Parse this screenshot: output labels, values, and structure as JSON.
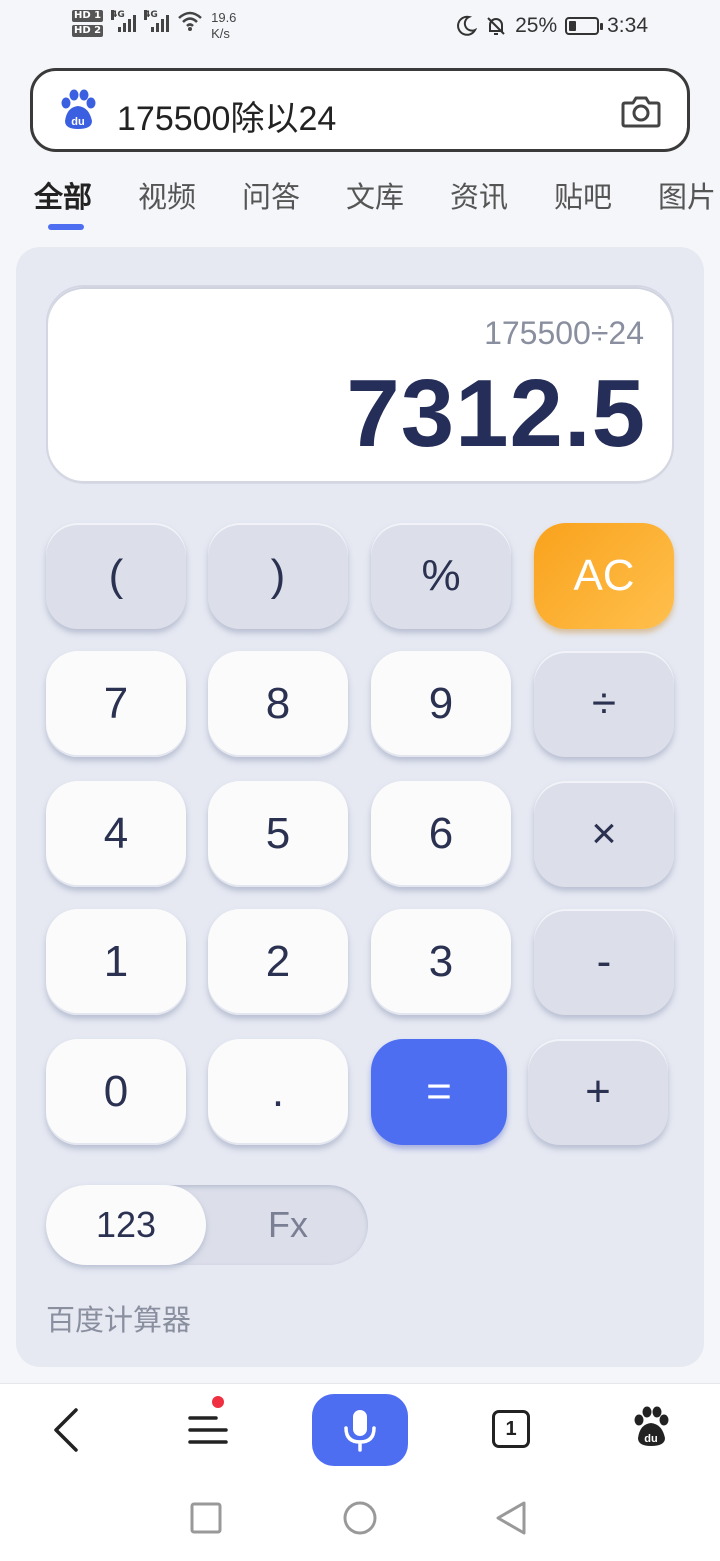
{
  "status": {
    "hd_labels": [
      "HD 1",
      "HD 2"
    ],
    "network": [
      "4G",
      "4G"
    ],
    "speed_value": "19.6",
    "speed_unit": "K/s",
    "battery": "25%",
    "battery_level": 0.25,
    "time": "3:34"
  },
  "search": {
    "query": "175500除以24",
    "logo": "baidu-paw-logo",
    "camera_icon": "camera-icon"
  },
  "tabs": [
    {
      "label": "全部",
      "active": true
    },
    {
      "label": "视频"
    },
    {
      "label": "问答"
    },
    {
      "label": "文库"
    },
    {
      "label": "资讯"
    },
    {
      "label": "贴吧"
    },
    {
      "label": "图片"
    }
  ],
  "calculator": {
    "expression": "175500÷24",
    "result": "7312.5",
    "keys": [
      [
        "(",
        ")",
        "%",
        "AC"
      ],
      [
        "7",
        "8",
        "9",
        "÷"
      ],
      [
        "4",
        "5",
        "6",
        "×"
      ],
      [
        "1",
        "2",
        "3",
        "-"
      ],
      [
        "0",
        ".",
        "=",
        "+"
      ]
    ],
    "mode_basic": "123",
    "mode_function": "Fx",
    "label": "百度计算器",
    "colors": {
      "ac": "#f9a21c",
      "equals": "#4e6ef2",
      "result_text": "#252e58"
    }
  },
  "bottom_nav": {
    "items": [
      "back-icon",
      "menu-icon",
      "voice-search-icon",
      "tabs-count-icon",
      "baidu-home-icon"
    ],
    "tab_count": "1"
  },
  "system_nav": [
    "recent-apps-icon",
    "home-icon",
    "back-triangle-icon"
  ]
}
